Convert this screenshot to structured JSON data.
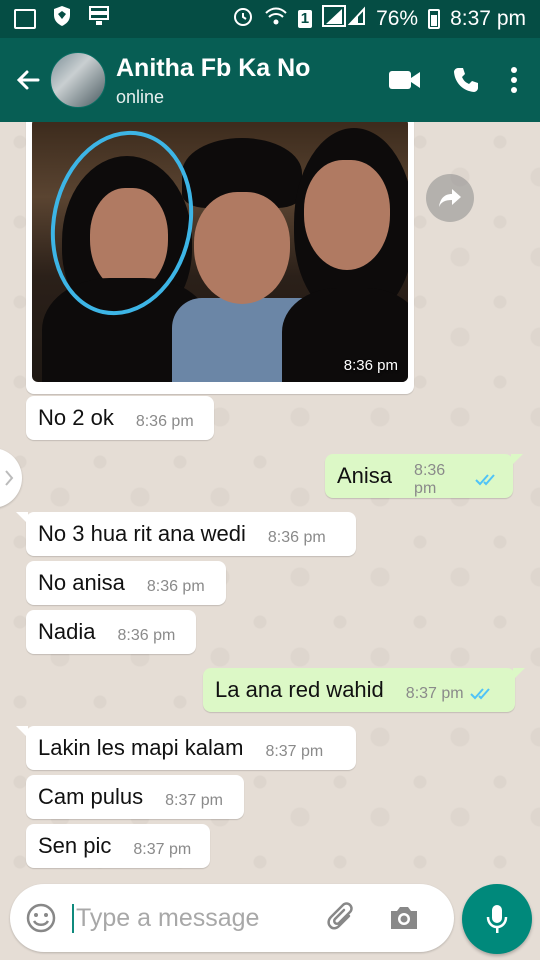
{
  "status_bar": {
    "battery": "76%",
    "time": "8:37 pm",
    "sim": "1"
  },
  "header": {
    "contact_name": "Anitha Fb Ka No",
    "status": "online"
  },
  "photo_message": {
    "time": "8:36 pm"
  },
  "messages": [
    {
      "text": "No 2 ok",
      "time": "8:36 pm",
      "direction": "incoming"
    },
    {
      "text": "Anisa",
      "time": "8:36 pm",
      "direction": "outgoing",
      "read": true
    },
    {
      "text": "No 3 hua rit ana wedi",
      "time": "8:36 pm",
      "direction": "incoming"
    },
    {
      "text": "No anisa",
      "time": "8:36 pm",
      "direction": "incoming"
    },
    {
      "text": "Nadia",
      "time": "8:36 pm",
      "direction": "incoming"
    },
    {
      "text": "La ana red wahid",
      "time": "8:37 pm",
      "direction": "outgoing",
      "read": true
    },
    {
      "text": "Lakin les mapi kalam",
      "time": "8:37 pm",
      "direction": "incoming"
    },
    {
      "text": "Cam pulus",
      "time": "8:37 pm",
      "direction": "incoming"
    },
    {
      "text": "Sen pic",
      "time": "8:37 pm",
      "direction": "incoming"
    }
  ],
  "composer": {
    "placeholder": "Type a message"
  },
  "colors": {
    "header": "#075e54",
    "status_bar": "#054d44",
    "outgoing_bubble": "#dcf8c6",
    "incoming_bubble": "#ffffff",
    "read_ticks": "#4fc3f7",
    "mic_button": "#00897b"
  },
  "icons": {
    "status_left": [
      "gallery-icon",
      "shield-icon",
      "storage-icon"
    ],
    "status_right": [
      "alarm-icon",
      "wifi-icon",
      "sim-icon",
      "signal-icon",
      "battery-icon"
    ],
    "header": [
      "back-arrow-icon",
      "video-call-icon",
      "phone-icon",
      "more-options-icon"
    ],
    "composer": [
      "emoji-icon",
      "attach-icon",
      "camera-icon",
      "mic-icon"
    ]
  }
}
